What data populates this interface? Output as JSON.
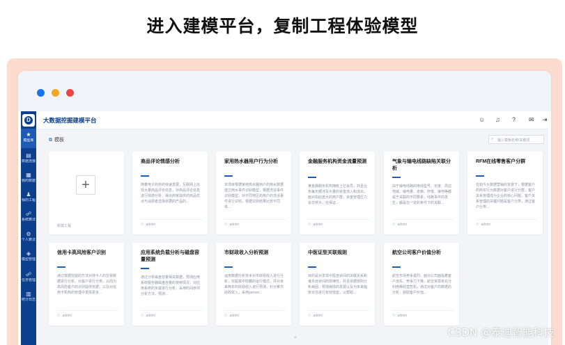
{
  "headline": "进入建模平台，复制工程体验模型",
  "app": {
    "title": "大数据挖掘建模平台",
    "logo": "D"
  },
  "sidebar": {
    "items": [
      {
        "label": "模型库",
        "icon": "star-icon",
        "glyph": "★",
        "active": true
      },
      {
        "label": "数据连接",
        "icon": "database-icon",
        "glyph": "▤",
        "active": false
      },
      {
        "label": "我的数据",
        "icon": "data-icon",
        "glyph": "▦",
        "active": false
      },
      {
        "label": "我的工程",
        "icon": "project-icon",
        "glyph": "♟",
        "active": false
      },
      {
        "label": "系统算法",
        "icon": "algorithm-icon",
        "glyph": "☍",
        "active": false
      },
      {
        "label": "个人算法",
        "icon": "personal-algorithm-icon",
        "glyph": "⚙",
        "active": false
      },
      {
        "label": "模型管理",
        "icon": "model-manage-icon",
        "glyph": "◈",
        "active": false
      },
      {
        "label": "任务管理",
        "icon": "task-icon",
        "glyph": "☍",
        "active": false
      },
      {
        "label": "统计日志",
        "icon": "log-icon",
        "glyph": "▥",
        "active": false
      }
    ]
  },
  "section": {
    "title": "模板",
    "search_placeholder": "输入模板名称/关键词"
  },
  "new_card": {
    "label": "新建工程"
  },
  "cards": [
    {
      "title": "商品评论情感分析",
      "desc": "随着电子商务的快速发展，互联网上出现大量商品评论信息，对商品评论信息进行情感分析，得出商家提供的商品优点与消费者选择依据的产品的...",
      "author": "admin"
    },
    {
      "title": "家用热水器用户行为分析",
      "desc": "本项目根据家用热水器用户的用水数据建立用水事件识别模型，根据洗浴事件识别模型，对不同地区的用户的洗浴事件进行识别，根据识别结果比较不同单...",
      "author": "admin"
    },
    {
      "title": "金融服务机构资金流量预测",
      "desc": "某金融服务机构拥有上亿会员，并且业务每天都涉及大量的资金流入和流出，面对如此庞大的用户群，资金管理压力会非常大，在保证...",
      "author": "admin"
    },
    {
      "title": "气象与输电线路缺陷关联分析",
      "desc": "由于输电线路的电线型号、长度、周边地域、输电量、走廊、杆塔、接地等都属于关联的不同要素，线路事件的发生，都是在一定的条件下的关联...",
      "author": "admin"
    },
    {
      "title": "RFM在线零售客户分群",
      "desc": "在如今大数据营销的背景下，根据客户的购买行为数据对客户进行分群，客户关系管理成为企业的核心问题，客户关系管理的关键问题是客户分类，通过客户分类...",
      "author": "admin"
    },
    {
      "title": "信用卡高风险客户识别",
      "desc": "通过数据挖掘的方法对持卡人的交易数据进行分析，对客户进行分类，从而为高风险客户的识别提供依据，以及对信用卡机构的管理中发挥更多...",
      "author": "admin"
    },
    {
      "title": "应用系统负载分析与磁盘容量预测",
      "desc": "通过分析磁盘容量相关数据，预测应用系统服务器磁盘容量的使用情况，对应用系统的负载进行分析，采用时间序列分析方法，预测...",
      "author": "admin"
    },
    {
      "title": "市财政收入分析预测",
      "desc": "运用数据分析技术对市财政收入进行分析，挖掘其中隐藏的运行模式，并对未来两年的财政收入进行预测，针对某市财政收入，采用person...",
      "author": "admin"
    },
    {
      "title": "中医证型关联规则",
      "desc": "目的是对发现中医症状间的关联关系和诸多症状间的规律性，并且依据规则分析病因、预测病情的发展以及为未来临床诊治进行有效借鉴，以帮助...",
      "author": "admin"
    },
    {
      "title": "航空公司客户价值分析",
      "desc": "航空市场竞争激烈，面对公司面临着客户流失、竞争力下降，航空资源未充分利用等经营危机，通过对客户的数据的分析，获取客户价值...",
      "author": "admin"
    }
  ],
  "watermark": "CSDN @泰迪智能科技"
}
